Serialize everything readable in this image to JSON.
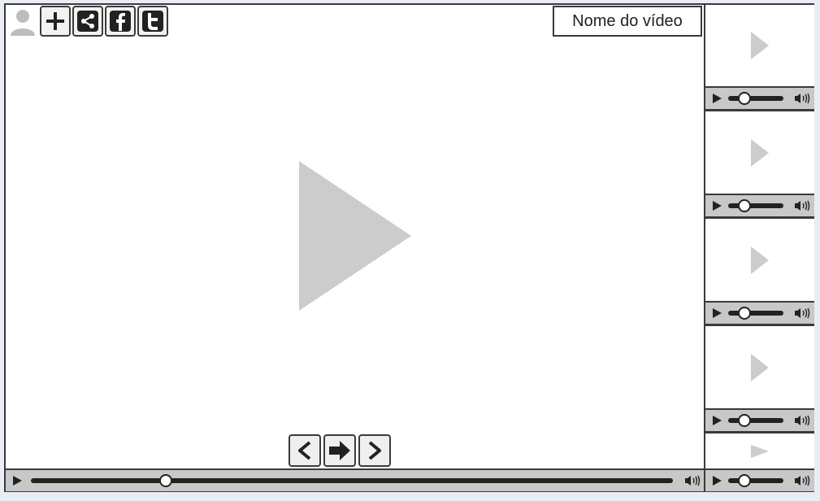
{
  "video": {
    "title": "Nome do vídeo",
    "progress_fraction": 0.21
  },
  "social_bar": [
    {
      "name": "user-avatar-icon"
    },
    {
      "name": "add-icon"
    },
    {
      "name": "share-icon"
    },
    {
      "name": "facebook-icon"
    },
    {
      "name": "twitter-icon"
    }
  ],
  "navigation": [
    {
      "name": "previous-video-button",
      "icon": "chevron-left-icon"
    },
    {
      "name": "next-arrow-button",
      "icon": "arrow-right-icon"
    },
    {
      "name": "next-video-button",
      "icon": "chevron-right-icon"
    }
  ],
  "related_videos": [
    {
      "progress_fraction": 0.3
    },
    {
      "progress_fraction": 0.3
    },
    {
      "progress_fraction": 0.3
    },
    {
      "progress_fraction": 0.3
    },
    {
      "progress_fraction": 0.3
    }
  ],
  "colors": {
    "border": "#3a3a3a",
    "control_bar": "#c8c8c8",
    "placeholder_play": "#cccccc"
  }
}
